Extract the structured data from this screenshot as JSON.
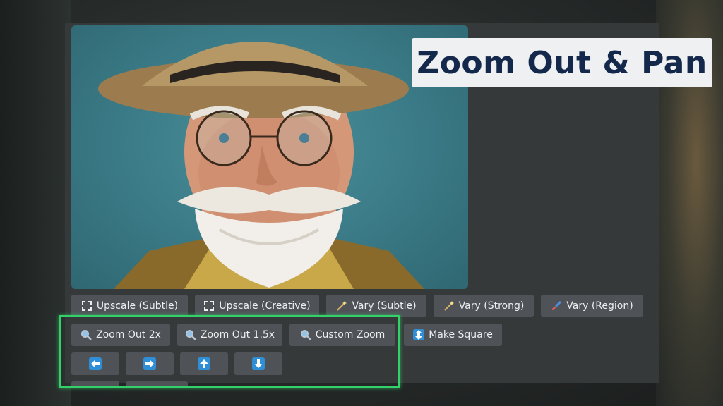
{
  "title": "Zoom Out & Pan",
  "image": {
    "subject": "portrait-photo"
  },
  "row1": [
    {
      "label": "Upscale (Subtle)",
      "icon": "expand-icon"
    },
    {
      "label": "Upscale (Creative)",
      "icon": "expand-icon"
    },
    {
      "label": "Vary (Subtle)",
      "icon": "magic-wand-icon"
    },
    {
      "label": "Vary (Strong)",
      "icon": "magic-wand-icon"
    },
    {
      "label": "Vary (Region)",
      "icon": "paintbrush-icon"
    }
  ],
  "row2": [
    {
      "label": "Zoom Out 2x",
      "icon": "magnifier-icon"
    },
    {
      "label": "Zoom Out 1.5x",
      "icon": "magnifier-icon"
    },
    {
      "label": "Custom Zoom",
      "icon": "magnifier-icon"
    },
    {
      "label": "Make Square",
      "icon": "up-down-arrow-icon"
    }
  ],
  "row3": [
    {
      "icon": "arrow-left-icon"
    },
    {
      "icon": "arrow-right-icon"
    },
    {
      "icon": "arrow-up-icon"
    },
    {
      "icon": "arrow-down-icon"
    }
  ],
  "colors": {
    "highlight": "#34d16a",
    "button_bg": "#4f5358",
    "title_text": "#13284a",
    "arrow_icon": "#2f8fd6"
  }
}
